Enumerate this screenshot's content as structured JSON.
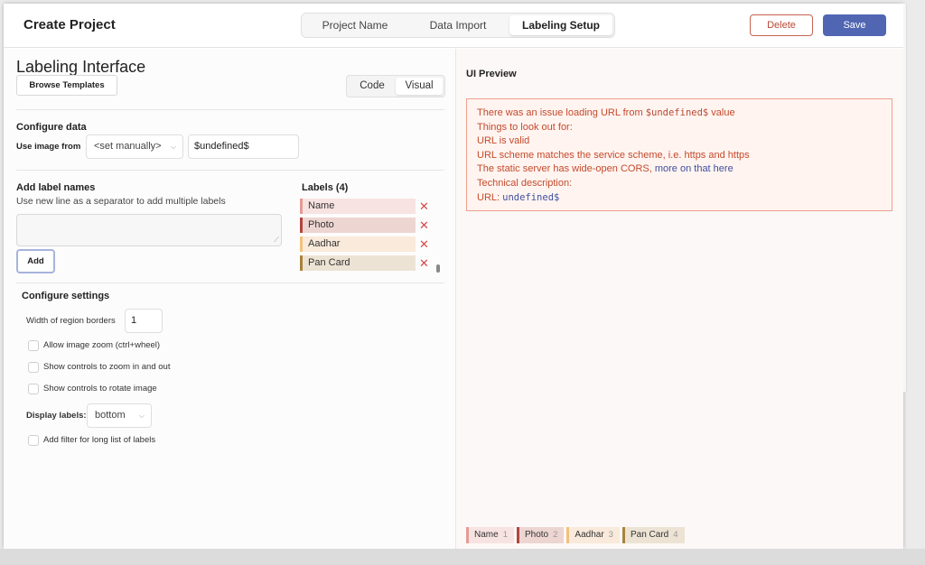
{
  "header": {
    "title": "Create Project",
    "steps": [
      "Project Name",
      "Data Import",
      "Labeling Setup"
    ],
    "delete_label": "Delete",
    "save_label": "Save"
  },
  "config": {
    "heading": "Labeling Interface",
    "browse_templates": "Browse Templates",
    "mode_toggle": [
      "Code",
      "Visual"
    ],
    "configure_data": {
      "title": "Configure data",
      "use_image_from_label": "Use image from",
      "source_select": "<set manually>",
      "value": "$undefined$"
    },
    "add_labels": {
      "title": "Add label names",
      "helper": "Use new line as a separator to add multiple labels",
      "add_button": "Add"
    },
    "labels": {
      "title": "Labels (4)",
      "items": [
        {
          "name": "Name",
          "color": "#e59b95",
          "bg": "#f7e3e1"
        },
        {
          "name": "Photo",
          "color": "#b3453d",
          "bg": "#edd5d2"
        },
        {
          "name": "Aadhar",
          "color": "#f1c27d",
          "bg": "#f9eadb"
        },
        {
          "name": "Pan Card",
          "color": "#a8833a",
          "bg": "#ece3d4"
        }
      ],
      "remove_icon": "✕"
    },
    "settings": {
      "title": "Configure settings",
      "region_border_label": "Width of region borders",
      "region_border_value": "1",
      "checkboxes": [
        "Allow image zoom (ctrl+wheel)",
        "Show controls to zoom in and out",
        "Show controls to rotate image"
      ],
      "display_labels_label": "Display labels:",
      "display_labels_value": "bottom",
      "filter_label": "Add filter for long list of labels"
    }
  },
  "preview": {
    "title": "UI Preview",
    "error": {
      "line1_pre": "There was an issue loading URL from ",
      "line1_code": "$undefined$",
      "line1_post": " value",
      "line2": "Things to look out for:",
      "line3": "URL is valid",
      "line4": "URL scheme matches the service scheme, i.e. https and https",
      "line5_pre": "The static server has wide-open CORS, ",
      "line5_link": "more on that here",
      "line6": "Technical description:",
      "line7_pre": "URL: ",
      "line7_code": "undefined$"
    },
    "chips": [
      {
        "name": "Name",
        "hotkey": "1"
      },
      {
        "name": "Photo",
        "hotkey": "2"
      },
      {
        "name": "Aadhar",
        "hotkey": "3"
      },
      {
        "name": "Pan Card",
        "hotkey": "4"
      }
    ]
  }
}
